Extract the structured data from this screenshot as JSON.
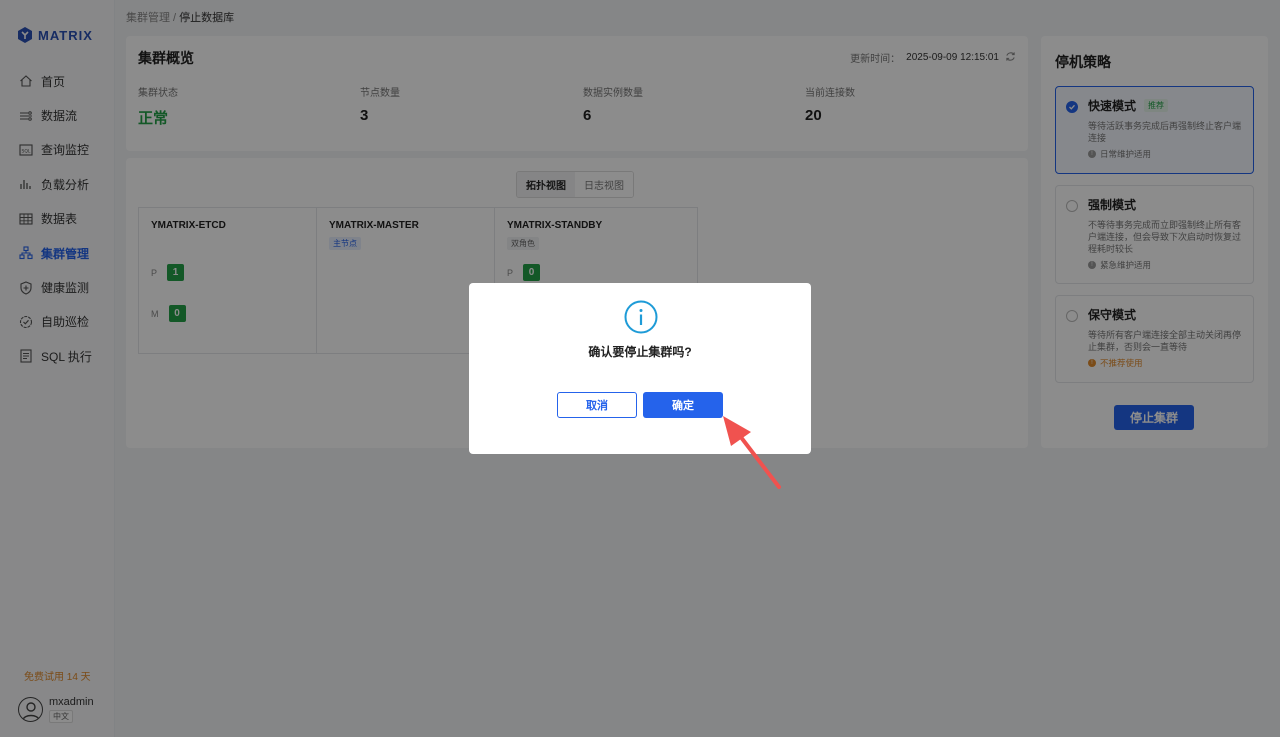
{
  "app": {
    "logo_text": "MATRIX"
  },
  "sidebar": {
    "items": [
      {
        "label": "首页",
        "icon": "home-icon"
      },
      {
        "label": "数据流",
        "icon": "dataflow-icon"
      },
      {
        "label": "查询监控",
        "icon": "sql-monitor-icon"
      },
      {
        "label": "负载分析",
        "icon": "bar-chart-icon"
      },
      {
        "label": "数据表",
        "icon": "table-icon"
      },
      {
        "label": "集群管理",
        "icon": "cluster-icon",
        "active": true
      },
      {
        "label": "健康监测",
        "icon": "shield-icon"
      },
      {
        "label": "自助巡检",
        "icon": "check-badge-icon"
      },
      {
        "label": "SQL 执行",
        "icon": "sql-exec-icon"
      }
    ],
    "trial": "免费试用 14 天",
    "user": {
      "name": "mxadmin",
      "lang": "中文"
    }
  },
  "breadcrumb": {
    "parent": "集群管理",
    "sep": " / ",
    "current": "停止数据库"
  },
  "overview": {
    "title": "集群概览",
    "update_label": "更新时间：",
    "update_time": "2025-09-09 12:15:01",
    "stats": [
      {
        "label": "集群状态",
        "value": "正常"
      },
      {
        "label": "节点数量",
        "value": "3"
      },
      {
        "label": "数据实例数量",
        "value": "6"
      },
      {
        "label": "当前连接数",
        "value": "20"
      }
    ]
  },
  "topology": {
    "tabs": [
      "拓扑视图",
      "日志视图"
    ],
    "nodes": [
      {
        "name": "YMATRIX-ETCD",
        "p_label": "P",
        "p_value": "1",
        "m_label": "M",
        "m_value": "0"
      },
      {
        "name": "YMATRIX-MASTER",
        "tag": "主节点"
      },
      {
        "name": "YMATRIX-STANDBY",
        "tag": "双角色",
        "p_label": "P",
        "p_value": "0"
      }
    ]
  },
  "strategy": {
    "title": "停机策略",
    "options": [
      {
        "name": "快速模式",
        "badge": "推荐",
        "desc": "等待活跃事务完成后再强制终止客户端连接",
        "note": "日常维护适用"
      },
      {
        "name": "强制模式",
        "desc": "不等待事务完成而立即强制终止所有客户端连接，但会导致下次启动时恢复过程耗时较长",
        "note": "紧急维护适用"
      },
      {
        "name": "保守模式",
        "desc": "等待所有客户端连接全部主动关闭再停止集群，否则会一直等待",
        "note": "不推荐使用"
      }
    ],
    "stop_button": "停止集群"
  },
  "modal": {
    "message": "确认要停止集群吗?",
    "cancel": "取消",
    "confirm": "确定"
  },
  "colors": {
    "accent": "#2563eb",
    "success": "#24a148",
    "warning": "#e08a2c",
    "annotation_arrow": "#f0524f"
  }
}
